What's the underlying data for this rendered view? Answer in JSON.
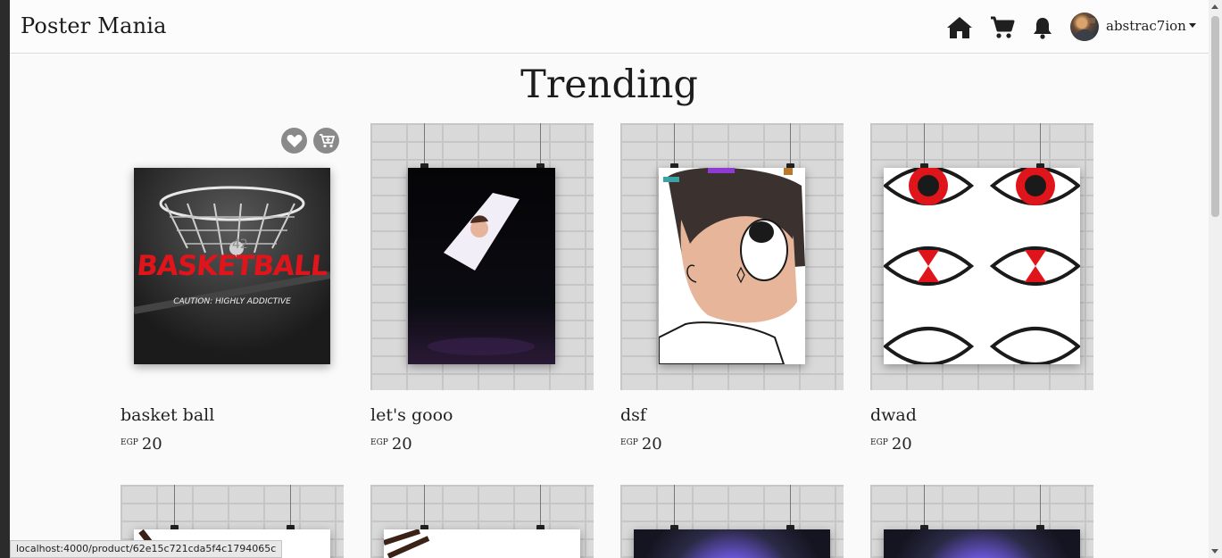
{
  "navbar": {
    "brand": "Poster Mania",
    "username": "abstrac7ion",
    "icons": {
      "home": "home-icon",
      "cart": "cart-icon",
      "notifications": "bell-icon"
    }
  },
  "main": {
    "heading": "Trending",
    "products": [
      {
        "title": "basket ball",
        "currency": "EGP",
        "price": "20",
        "poster_text": "BASKETBALL",
        "poster_subtext": "CAUTION: HIGHLY ADDICTIVE"
      },
      {
        "title": "let's gooo",
        "currency": "EGP",
        "price": "20"
      },
      {
        "title": "dsf",
        "currency": "EGP",
        "price": "20"
      },
      {
        "title": "dwad",
        "currency": "EGP",
        "price": "20"
      }
    ],
    "hover_actions": {
      "favorite_icon": "heart-icon",
      "add_to_cart_icon": "cart-plus-icon"
    }
  },
  "status_bar": {
    "url": "localhost:4000/product/62e15c721cda5f4c1794065c"
  },
  "colors": {
    "accent_red": "#e0141b",
    "icon_dark": "#1f1f1f",
    "hover_button": "#8a8a8a"
  }
}
